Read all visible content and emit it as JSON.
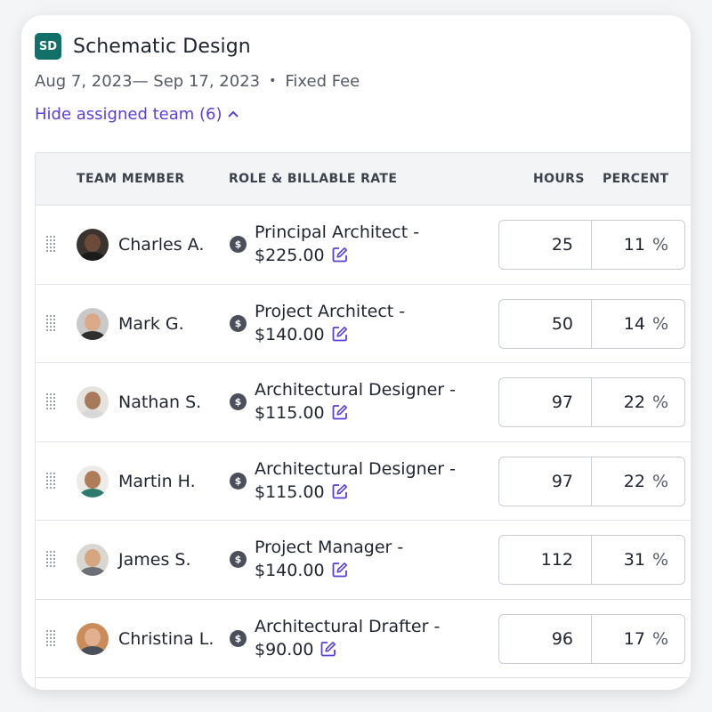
{
  "phase": {
    "badge": "SD",
    "title": "Schematic Design",
    "date_range": "Aug 7, 2023— Sep 17, 2023",
    "fee_type": "Fixed Fee",
    "toggle_label": "Hide assigned team (6)"
  },
  "table": {
    "columns": {
      "member": "TEAM MEMBER",
      "role": "ROLE & BILLABLE RATE",
      "hours": "HOURS",
      "percent": "PERCENT"
    },
    "rows": [
      {
        "name": "Charles A.",
        "role": "Principal Architect -",
        "rate": "$225.00",
        "hours": "25",
        "percent": "11"
      },
      {
        "name": "Mark G.",
        "role": "Project Architect -",
        "rate": "$140.00",
        "hours": "50",
        "percent": "14"
      },
      {
        "name": "Nathan S.",
        "role": "Architectural Designer -",
        "rate": "$115.00",
        "hours": "97",
        "percent": "22"
      },
      {
        "name": "Martin H.",
        "role": "Architectural Designer -",
        "rate": "$115.00",
        "hours": "97",
        "percent": "22"
      },
      {
        "name": "James S.",
        "role": "Project Manager -",
        "rate": "$140.00",
        "hours": "112",
        "percent": "31"
      },
      {
        "name": "Christina L.",
        "role": "Architectural Drafter -",
        "rate": "$90.00",
        "hours": "96",
        "percent": "17"
      }
    ],
    "percent_symbol": "%",
    "dollar_symbol": "$"
  },
  "icons": {
    "phase_badge": "phase-badge-icon",
    "toggle": "chevron-up-icon",
    "drag": "drag-handle-icon",
    "rate": "dollar-circle-icon",
    "edit": "edit-pencil-icon"
  },
  "colors": {
    "badge": "#137068",
    "link": "#5b3fd6",
    "edit_icon": "#5b3fd6"
  }
}
